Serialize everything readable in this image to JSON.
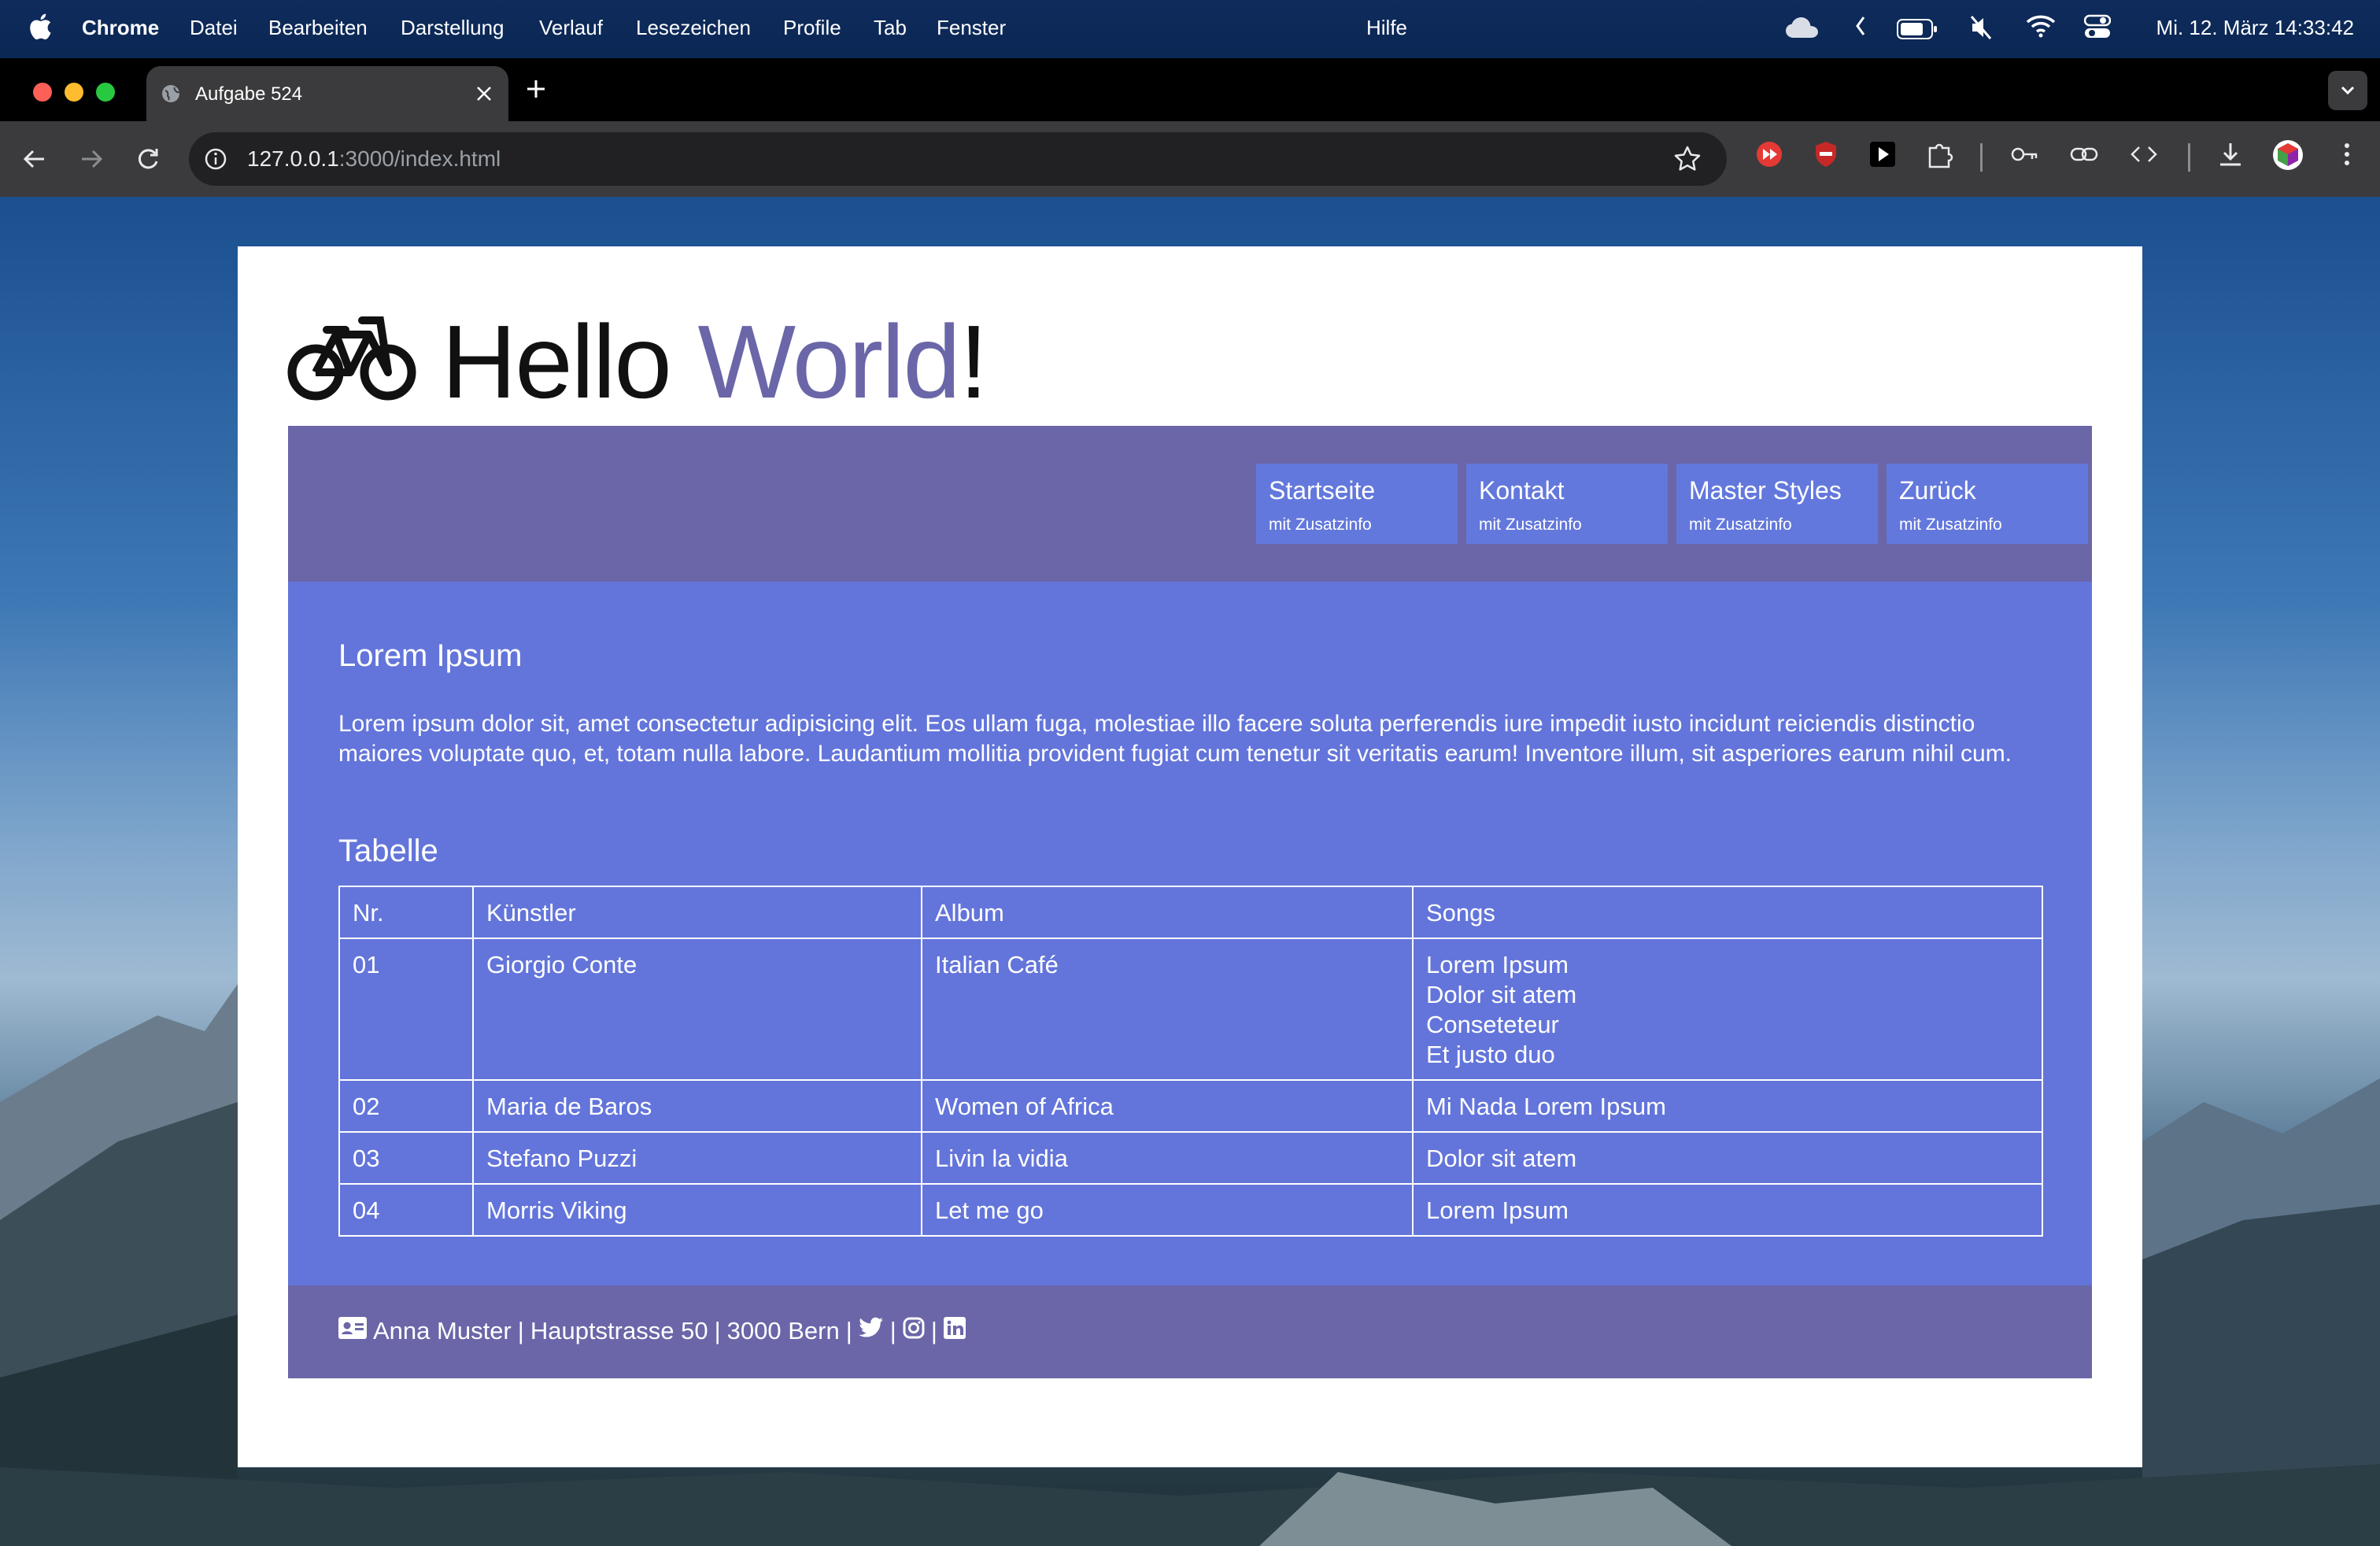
{
  "menubar": {
    "app": "Chrome",
    "items": [
      "Datei",
      "Bearbeiten",
      "Darstellung",
      "Verlauf",
      "Lesezeichen",
      "Profile",
      "Tab",
      "Fenster"
    ],
    "help": "Hilfe",
    "clock": "Mi. 12. März  14:33:42"
  },
  "browser": {
    "tab_title": "Aufgabe 524",
    "url_host": "127.0.0.1",
    "url_rest": ":3000/index.html"
  },
  "page": {
    "heading_part1": "Hello ",
    "heading_part2": "World",
    "heading_part3": "!",
    "nav": [
      {
        "label": "Startseite",
        "sub": "mit Zusatzinfo"
      },
      {
        "label": "Kontakt",
        "sub": "mit Zusatzinfo"
      },
      {
        "label": "Master Styles",
        "sub": "mit Zusatzinfo"
      },
      {
        "label": "Zurück",
        "sub": "mit Zusatzinfo"
      }
    ],
    "section_title": "Lorem Ipsum",
    "paragraph": "Lorem ipsum dolor sit, amet consectetur adipisicing elit. Eos ullam fuga, molestiae illo facere soluta perferendis iure impedit iusto incidunt reiciendis distinctio maiores voluptate quo, et, totam nulla labore. Laudantium mollitia provident fugiat cum tenetur sit veritatis earum! Inventore illum, sit asperiores earum nihil cum.",
    "table_title": "Tabelle",
    "table": {
      "headers": [
        "Nr.",
        "Künstler",
        "Album",
        "Songs"
      ],
      "rows": [
        {
          "nr": "01",
          "artist": "Giorgio Conte",
          "album": "Italian Café",
          "songs": [
            "Lorem Ipsum",
            "Dolor sit atem",
            "Conseteteur",
            "Et justo duo"
          ]
        },
        {
          "nr": "02",
          "artist": "Maria de Baros",
          "album": "Women of Africa",
          "songs": [
            "Mi Nada Lorem Ipsum"
          ]
        },
        {
          "nr": "03",
          "artist": "Stefano Puzzi",
          "album": "Livin la vidia",
          "songs": [
            "Dolor sit atem"
          ]
        },
        {
          "nr": "04",
          "artist": "Morris Viking",
          "album": "Let me go",
          "songs": [
            "Lorem Ipsum"
          ]
        }
      ]
    },
    "footer": {
      "name": "Anna Muster",
      "street": "Hauptstrasse 50",
      "city": "3000 Bern",
      "sep": "|"
    }
  },
  "colors": {
    "navbar": "#6a66a8",
    "content": "#6375da",
    "navbutton": "#6378dc",
    "heading_accent": "#6a66a8"
  }
}
